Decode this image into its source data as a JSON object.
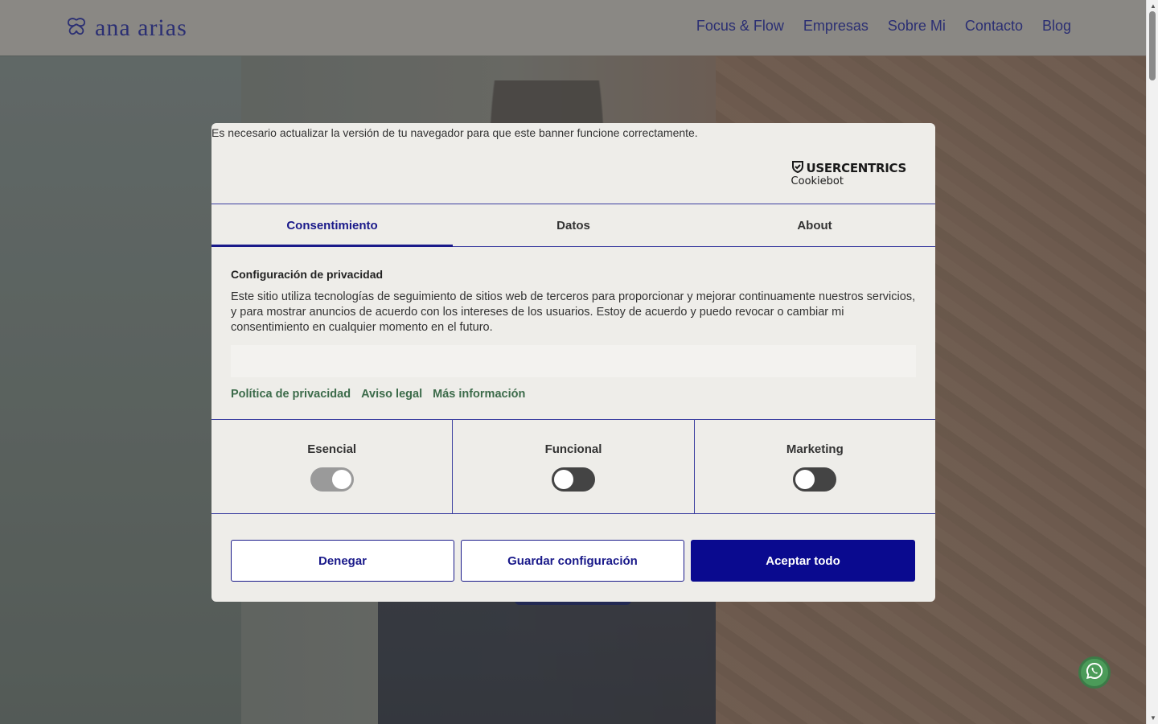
{
  "header": {
    "logo_text": "ana arias",
    "nav": [
      "Focus & Flow",
      "Empresas",
      "Sobre Mi",
      "Contacto",
      "Blog"
    ]
  },
  "cookie_banner": {
    "browser_warning": "Es necesario actualizar la versión de tu navegador para que este banner funcione correctamente.",
    "brand": {
      "name": "USERCENTRICS",
      "product": "Cookiebot"
    },
    "tabs": [
      "Consentimiento",
      "Datos",
      "About"
    ],
    "active_tab": "Consentimiento",
    "heading": "Configuración de privacidad",
    "body": "Este sitio utiliza tecnologías de seguimiento de sitios web de terceros para proporcionar y mejorar continuamente nuestros servicios, y para mostrar anuncios de acuerdo con los intereses de los usuarios. Estoy de acuerdo y puedo revocar o cambiar mi consentimiento en cualquier momento en el futuro.",
    "links": [
      "Política de privacidad",
      "Aviso legal",
      "Más información"
    ],
    "categories": [
      {
        "label": "Esencial",
        "enabled": true,
        "disabled": true
      },
      {
        "label": "Funcional",
        "enabled": false
      },
      {
        "label": "Marketing",
        "enabled": false
      }
    ],
    "buttons": {
      "deny": "Denegar",
      "save": "Guardar configuración",
      "accept_all": "Aceptar todo"
    }
  },
  "colors": {
    "brand_navy": "#0a0a8f",
    "link_green": "#3c6b4a",
    "dialog_bg": "#eeede9",
    "whatsapp": "#4b9b59"
  }
}
